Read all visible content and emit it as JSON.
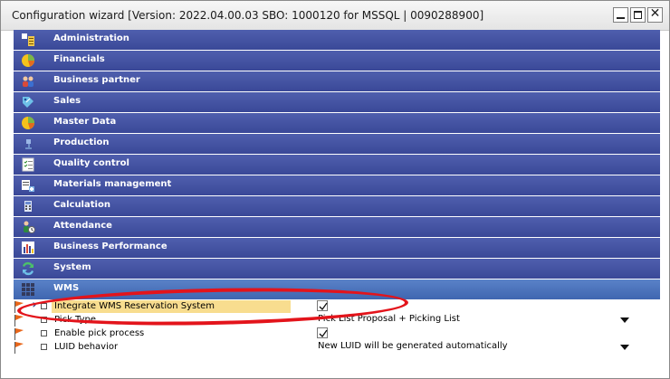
{
  "window": {
    "title": "Configuration wizard [Version: 2022.04.00.03 SBO: 1000120 for MSSQL | 0090288900]"
  },
  "categories": [
    {
      "label": "Administration",
      "icon": "administration-icon"
    },
    {
      "label": "Financials",
      "icon": "pie-chart-icon"
    },
    {
      "label": "Business partner",
      "icon": "people-icon"
    },
    {
      "label": "Sales",
      "icon": "sales-icon"
    },
    {
      "label": "Master Data",
      "icon": "pie-chart-icon"
    },
    {
      "label": "Production",
      "icon": "production-icon"
    },
    {
      "label": "Quality control",
      "icon": "checklist-icon"
    },
    {
      "label": "Materials management",
      "icon": "materials-icon"
    },
    {
      "label": "Calculation",
      "icon": "calculator-icon"
    },
    {
      "label": "Attendance",
      "icon": "attendance-icon"
    },
    {
      "label": "Business Performance",
      "icon": "bar-chart-icon"
    },
    {
      "label": "System",
      "icon": "system-icon"
    },
    {
      "label": "WMS",
      "icon": "grid-icon"
    }
  ],
  "wms_settings": [
    {
      "label": "Integrate WMS Reservation System",
      "type": "checkbox",
      "checked": true
    },
    {
      "label": "Pick Type",
      "type": "dropdown",
      "value": "Pick List Proposal + Picking List"
    },
    {
      "label": "Enable pick process",
      "type": "checkbox",
      "checked": true
    },
    {
      "label": "LUID behavior",
      "type": "dropdown",
      "value": "New LUID will be generated automatically"
    }
  ],
  "colors": {
    "category_bar": "#3f4d9f",
    "active_category_bar": "#4a73bc",
    "highlight": "#f8dd8f",
    "annotation": "#e3141b",
    "flag": "#e8661a"
  }
}
